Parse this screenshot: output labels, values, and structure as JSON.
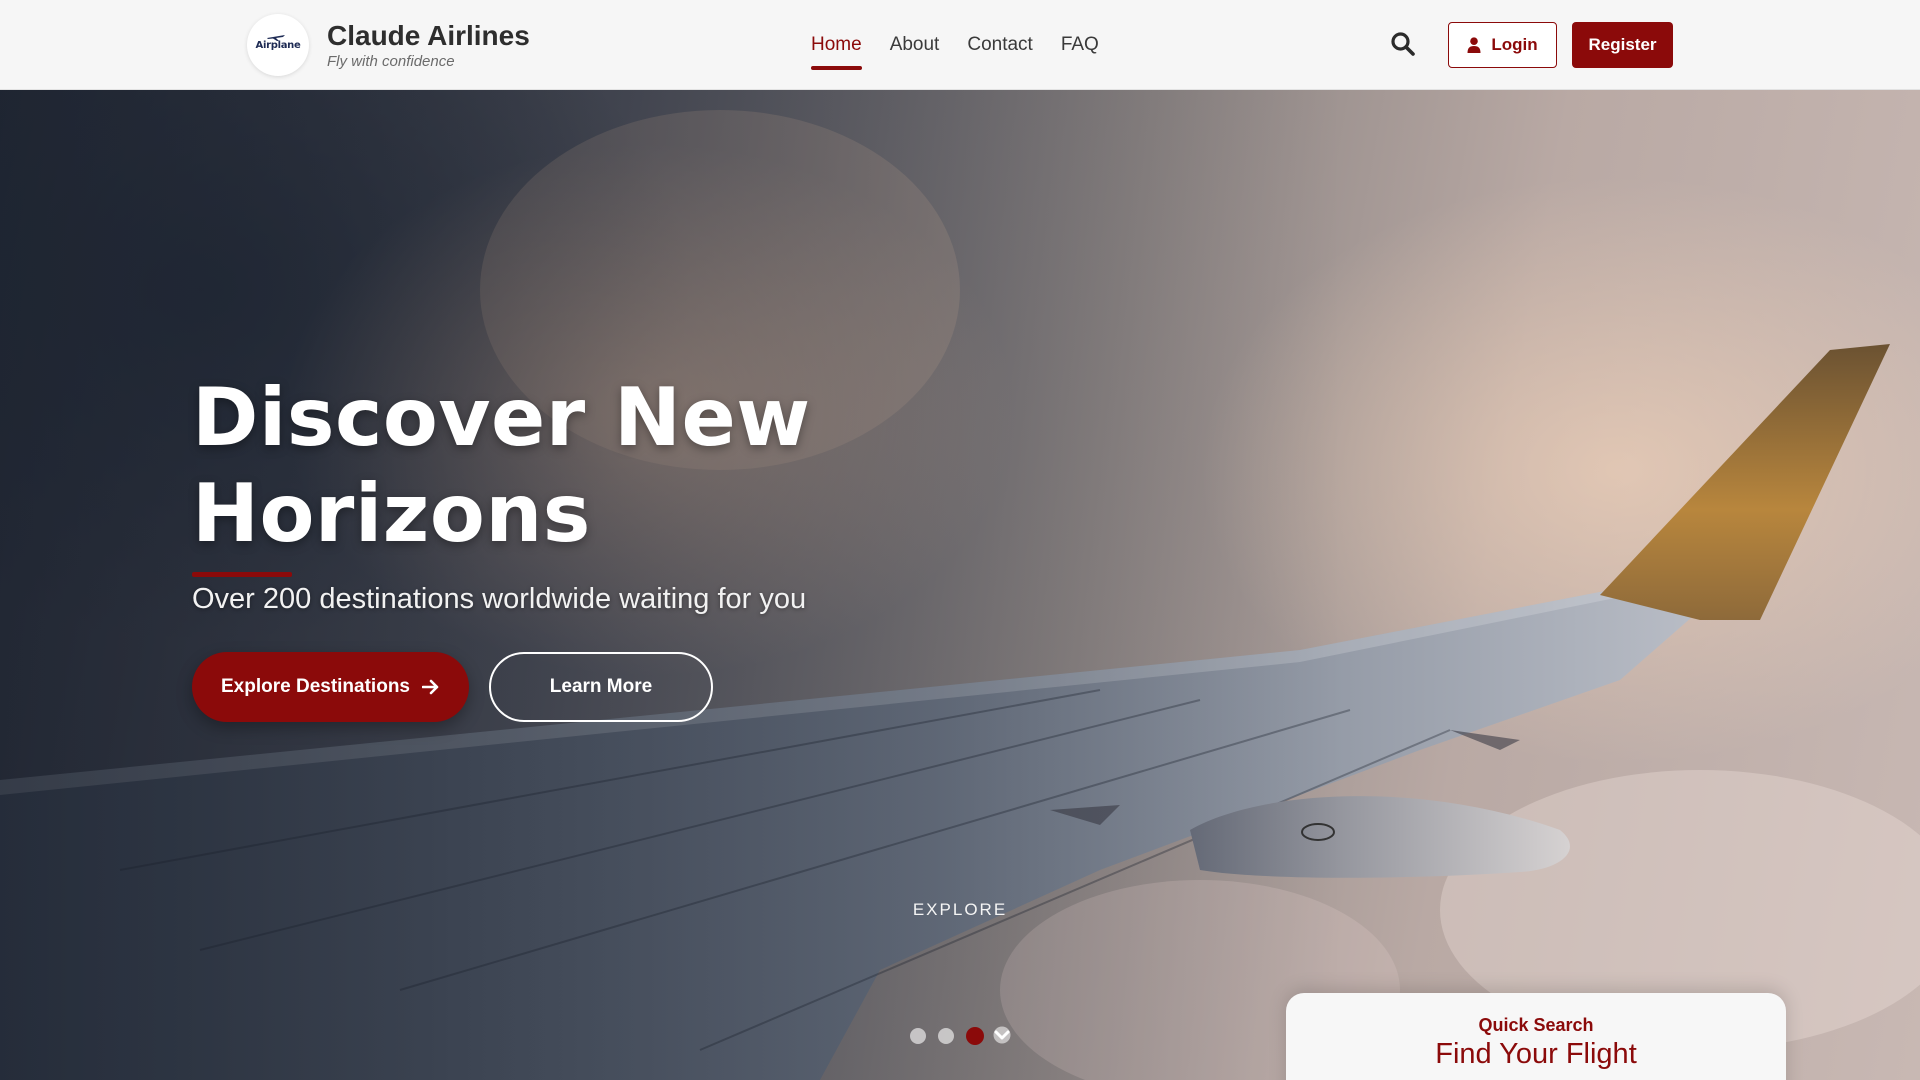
{
  "header": {
    "logo_text": "Airplane",
    "brand_name": "Claude Airlines",
    "tagline": "Fly with confidence",
    "nav": [
      {
        "label": "Home",
        "active": true
      },
      {
        "label": "About",
        "active": false
      },
      {
        "label": "Contact",
        "active": false
      },
      {
        "label": "FAQ",
        "active": false
      }
    ],
    "search_icon": "search-icon",
    "login_label": "Login",
    "login_icon": "user-icon",
    "register_label": "Register"
  },
  "hero": {
    "title": "Discover New Horizons",
    "subtitle": "Over 200 destinations worldwide waiting for you",
    "explore_button": "Explore Destinations",
    "explore_button_icon": "arrow-right-icon",
    "learn_button": "Learn More",
    "scroll_label": "EXPLORE",
    "slides": 3,
    "active_slide": 3
  },
  "quick_search": {
    "label": "Quick Search",
    "title": "Find Your Flight"
  },
  "colors": {
    "accent": "#8b0a0a",
    "header_bg": "#f6f6f6",
    "text_dark": "#2e2e2e"
  }
}
